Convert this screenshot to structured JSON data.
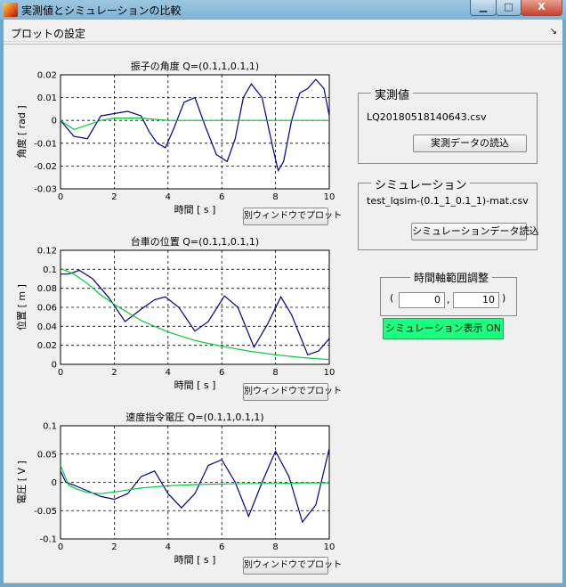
{
  "window": {
    "title": "実測値とシミュレーションの比較",
    "min": "▁",
    "max": "□",
    "close": "X"
  },
  "panel": {
    "title": "プロットの設定",
    "collapse_icon": "↘"
  },
  "plots": [
    {
      "title": "振子の角度 Q=(0.1,1,0.1,1)",
      "ylabel": "角度 [ rad ]",
      "xlabel": "時間 [ s ]",
      "yticks": [
        "0.02",
        "0.01",
        "0",
        "-0.01",
        "-0.02",
        "-0.03"
      ],
      "xticks": [
        "0",
        "2",
        "4",
        "6",
        "8",
        "10"
      ],
      "button": "別ウィンドウでプロット"
    },
    {
      "title": "台車の位置 Q=(0.1,1,0.1,1)",
      "ylabel": "位置 [ m ]",
      "xlabel": "時間 [ s ]",
      "yticks": [
        "0.1",
        "0.08",
        "0.06",
        "0.04",
        "0.02",
        "0"
      ],
      "ytop": "0.12",
      "xticks": [
        "0",
        "2",
        "4",
        "6",
        "8",
        "10"
      ],
      "button": "別ウィンドウでプロット"
    },
    {
      "title": "速度指令電圧 Q=(0.1,1,0.1,1)",
      "ylabel": "電圧 [ V ]",
      "xlabel": "時間 [ s ]",
      "yticks": [
        "0.1",
        "0.05",
        "0",
        "-0.05",
        "-0.1"
      ],
      "xticks": [
        "0",
        "2",
        "4",
        "6",
        "8",
        "10"
      ],
      "button": "別ウィンドウでプロット"
    }
  ],
  "chart_data": [
    {
      "type": "line",
      "title": "振子の角度 Q=(0.1,1,0.1,1)",
      "xlabel": "時間 [ s ]",
      "ylabel": "角度 [ rad ]",
      "xlim": [
        0,
        10
      ],
      "ylim": [
        -0.03,
        0.02
      ],
      "grid": true,
      "series": [
        {
          "color": "#00008b",
          "x": [
            0,
            0.5,
            1,
            1.5,
            2,
            2.5,
            3,
            3.3,
            3.6,
            3.9,
            4.2,
            4.6,
            5,
            5.4,
            5.8,
            6.2,
            6.5,
            6.8,
            7.1,
            7.5,
            7.9,
            8.1,
            8.3,
            8.6,
            8.9,
            9.2,
            9.5,
            9.8,
            10
          ],
          "y": [
            0.0,
            -0.007,
            -0.008,
            0.002,
            0.003,
            0.004,
            0.002,
            -0.005,
            -0.01,
            -0.012,
            -0.004,
            0.008,
            0.01,
            -0.003,
            -0.015,
            -0.018,
            -0.008,
            0.01,
            0.016,
            0.01,
            -0.012,
            -0.022,
            -0.018,
            0.0,
            0.012,
            0.014,
            0.018,
            0.014,
            0.002
          ]
        },
        {
          "color": "#00cc33",
          "x": [
            0,
            0.5,
            1,
            1.5,
            2,
            3,
            4,
            5,
            6,
            7,
            8,
            9,
            10
          ],
          "y": [
            0.0,
            -0.004,
            -0.002,
            0.0,
            0.001,
            0.001,
            0.0,
            0.0,
            0.0,
            0.0,
            0.0,
            0.0,
            0.0
          ]
        }
      ]
    },
    {
      "type": "line",
      "title": "台車の位置 Q=(0.1,1,0.1,1)",
      "xlabel": "時間 [ s ]",
      "ylabel": "位置 [ m ]",
      "xlim": [
        0,
        10
      ],
      "ylim": [
        0,
        0.12
      ],
      "grid": true,
      "series": [
        {
          "color": "#00008b",
          "x": [
            0,
            0.3,
            0.7,
            1.2,
            1.8,
            2.4,
            3,
            3.5,
            3.9,
            4.4,
            5,
            5.5,
            6.1,
            6.6,
            7.2,
            7.7,
            8.2,
            8.6,
            9.2,
            9.6,
            10
          ],
          "y": [
            0.095,
            0.095,
            0.099,
            0.09,
            0.07,
            0.045,
            0.058,
            0.068,
            0.071,
            0.06,
            0.035,
            0.045,
            0.072,
            0.06,
            0.018,
            0.042,
            0.071,
            0.052,
            0.01,
            0.014,
            0.027
          ]
        },
        {
          "color": "#00cc33",
          "x": [
            0,
            0.5,
            1,
            1.5,
            2,
            3,
            4,
            5,
            6,
            7,
            8,
            9,
            10
          ],
          "y": [
            0.101,
            0.095,
            0.085,
            0.073,
            0.063,
            0.046,
            0.034,
            0.025,
            0.019,
            0.014,
            0.01,
            0.007,
            0.005
          ]
        }
      ]
    },
    {
      "type": "line",
      "title": "速度指令電圧 Q=(0.1,1,0.1,1)",
      "xlabel": "時間 [ s ]",
      "ylabel": "電圧 [ V ]",
      "xlim": [
        0,
        10
      ],
      "ylim": [
        -0.1,
        0.1
      ],
      "grid": true,
      "series": [
        {
          "color": "#00008b",
          "x": [
            0,
            0.2,
            0.5,
            1,
            1.5,
            2,
            2.5,
            3,
            3.5,
            4,
            4.5,
            5,
            5.5,
            6,
            6.5,
            7,
            7.5,
            8,
            8.5,
            9,
            9.5,
            10
          ],
          "y": [
            0.02,
            0.0,
            -0.005,
            -0.015,
            -0.025,
            -0.03,
            -0.02,
            0.01,
            0.02,
            -0.02,
            -0.045,
            -0.02,
            0.03,
            0.04,
            0.0,
            -0.06,
            0.0,
            0.055,
            0.01,
            -0.07,
            -0.04,
            0.06
          ]
        },
        {
          "color": "#00cc33",
          "x": [
            0,
            0.3,
            0.6,
            1,
            1.5,
            2,
            3,
            4,
            5,
            6,
            7,
            8,
            9,
            10
          ],
          "y": [
            0.03,
            -0.005,
            -0.012,
            -0.018,
            -0.02,
            -0.017,
            -0.01,
            -0.006,
            -0.004,
            -0.003,
            -0.002,
            -0.002,
            -0.001,
            -0.001
          ]
        }
      ]
    }
  ],
  "measured": {
    "title": "実測値",
    "filename": "LQ20180518140643.csv",
    "button": "実測データの読込"
  },
  "simulation": {
    "title": "シミュレーション",
    "filename": "test_lqsim-(0.1_1_0.1_1)-mat.csv",
    "button": "シミュレーションデータ読込"
  },
  "time_range": {
    "title": "時間軸範囲調整",
    "open_paren": "(",
    "comma": ",",
    "close_paren": ")",
    "min": "0",
    "max": "10"
  },
  "toggle": {
    "label": "シミュレーション表示 ON"
  },
  "colors": {
    "measured": "#00008b",
    "simulation": "#00cc33"
  }
}
